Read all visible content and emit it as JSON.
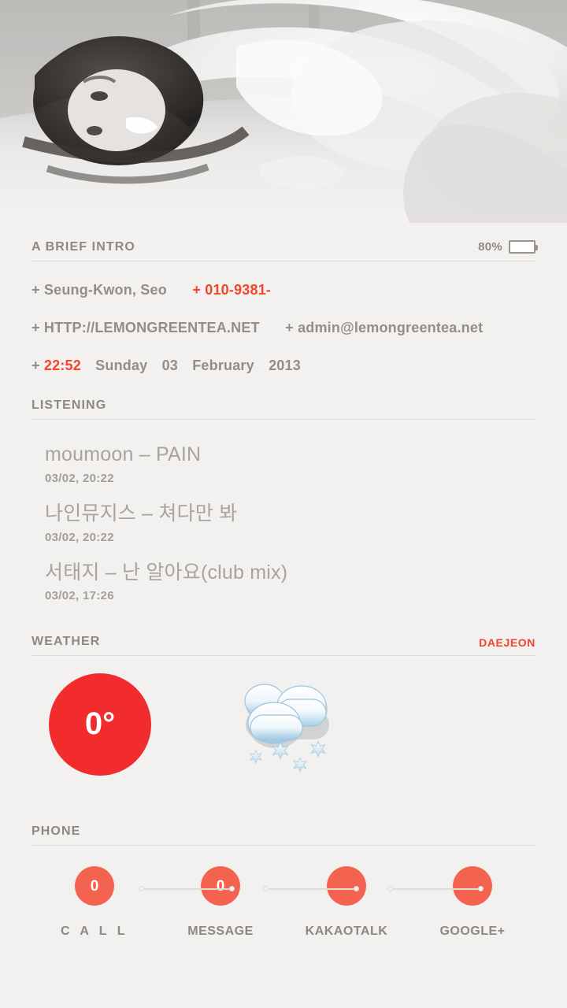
{
  "hero": {
    "alt": "grayscale portrait photo of woman lying on bed"
  },
  "intro": {
    "title": "A BRIEF INTRO",
    "battery": {
      "percent_label": "80%",
      "level": 80,
      "fill_color": "#2fd166"
    },
    "name_plus": "+",
    "name": "Seung-Kwon, Seo",
    "phone_plus": "+",
    "phone": "010-9381-",
    "url_plus": "+",
    "url": "HTTP://LEMONGREENTEA.NET",
    "email_plus": "+",
    "email": "admin@lemongreentea.net",
    "time_plus": "+",
    "time": "22:52",
    "weekday": "Sunday",
    "day": "03",
    "month": "February",
    "year": "2013"
  },
  "listening": {
    "title": "LISTENING",
    "tracks": [
      {
        "title": "moumoon – PAIN",
        "time": "03/02, 20:22"
      },
      {
        "title": "나인뮤지스 – 쳐다만 봐",
        "time": "03/02, 20:22"
      },
      {
        "title": "서태지 – 난 알아요(club mix)",
        "time": "03/02, 17:26"
      }
    ]
  },
  "weather": {
    "title": "WEATHER",
    "location": "DAEJEON",
    "temperature": "0°",
    "temp_color": "#f22c2c",
    "condition_icon": "snow-cloud-icon"
  },
  "phone": {
    "title": "PHONE",
    "badge_color": "#f4634f",
    "shortcuts": [
      {
        "label": "C A L L",
        "count": "0",
        "icon": "call-badge-icon"
      },
      {
        "label": "MESSAGE",
        "count": "0",
        "icon": "message-badge-icon"
      },
      {
        "label": "KAKAOTALK",
        "count": "",
        "icon": "kakaotalk-badge-icon"
      },
      {
        "label": "GOOGLE+",
        "count": "",
        "icon": "googleplus-badge-icon"
      }
    ]
  }
}
